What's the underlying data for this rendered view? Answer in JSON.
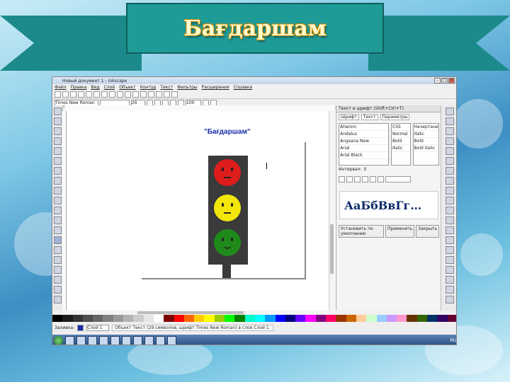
{
  "slide": {
    "title": "Бағдаршам"
  },
  "window": {
    "title": "Новый документ 1 - Inkscape",
    "menu": [
      "Файл",
      "Правка",
      "Вид",
      "Слой",
      "Объект",
      "Контур",
      "Текст",
      "Фильтры",
      "Расширения",
      "Справка"
    ],
    "toolbar": {
      "font_family": "Times New Roman",
      "font_size": "26",
      "zoom": "100"
    }
  },
  "canvas": {
    "text_object": "\"Бағдаршам\"",
    "lights": [
      {
        "color": "#dd1c1c",
        "label": "red-light"
      },
      {
        "color": "#f2e60a",
        "label": "yellow-light"
      },
      {
        "color": "#1f8a1a",
        "label": "green-light"
      }
    ]
  },
  "text_panel": {
    "header": "Текст и шрифт (Shift+Ctrl+T)",
    "tabs": [
      "Шрифт",
      "Текст",
      "Параметры"
    ],
    "families": [
      "Aharoni",
      "Andalus",
      "Angsana New",
      "Arial",
      "Arial Black"
    ],
    "styles": [
      "CSS",
      "Normal",
      "Bold",
      "Italic"
    ],
    "style_faces": [
      "Начертание",
      "Italic",
      "Bold",
      "Bold Italic"
    ],
    "spacing_label": "Интервал:",
    "spacing_value": "0",
    "preview": "АаБбВвГг…",
    "buttons": [
      "Установить по умолчанию",
      "Применить",
      "Закрыть"
    ]
  },
  "palette": [
    "#000000",
    "#1a1a1a",
    "#333333",
    "#4d4d4d",
    "#666666",
    "#808080",
    "#999999",
    "#b3b3b3",
    "#cccccc",
    "#e6e6e6",
    "#ffffff",
    "#800000",
    "#ff0000",
    "#ff6600",
    "#ffcc00",
    "#ffff00",
    "#99cc00",
    "#00ff00",
    "#008000",
    "#00ffcc",
    "#00ffff",
    "#0099ff",
    "#0000ff",
    "#000080",
    "#6600ff",
    "#ff00ff",
    "#800080",
    "#ff0066",
    "#993300",
    "#cc6600",
    "#ffcc99",
    "#ccffcc",
    "#99ccff",
    "#cc99ff",
    "#ff99cc",
    "#663300",
    "#336600",
    "#003366",
    "#330066",
    "#660033"
  ],
  "status": {
    "coords_label": "Заливка:",
    "layer": "Слой 1",
    "message": "Объект Текст (29 символов, шрифт Times New Roman) в слое Слой 1."
  },
  "taskbar": {
    "clock": "RU"
  }
}
